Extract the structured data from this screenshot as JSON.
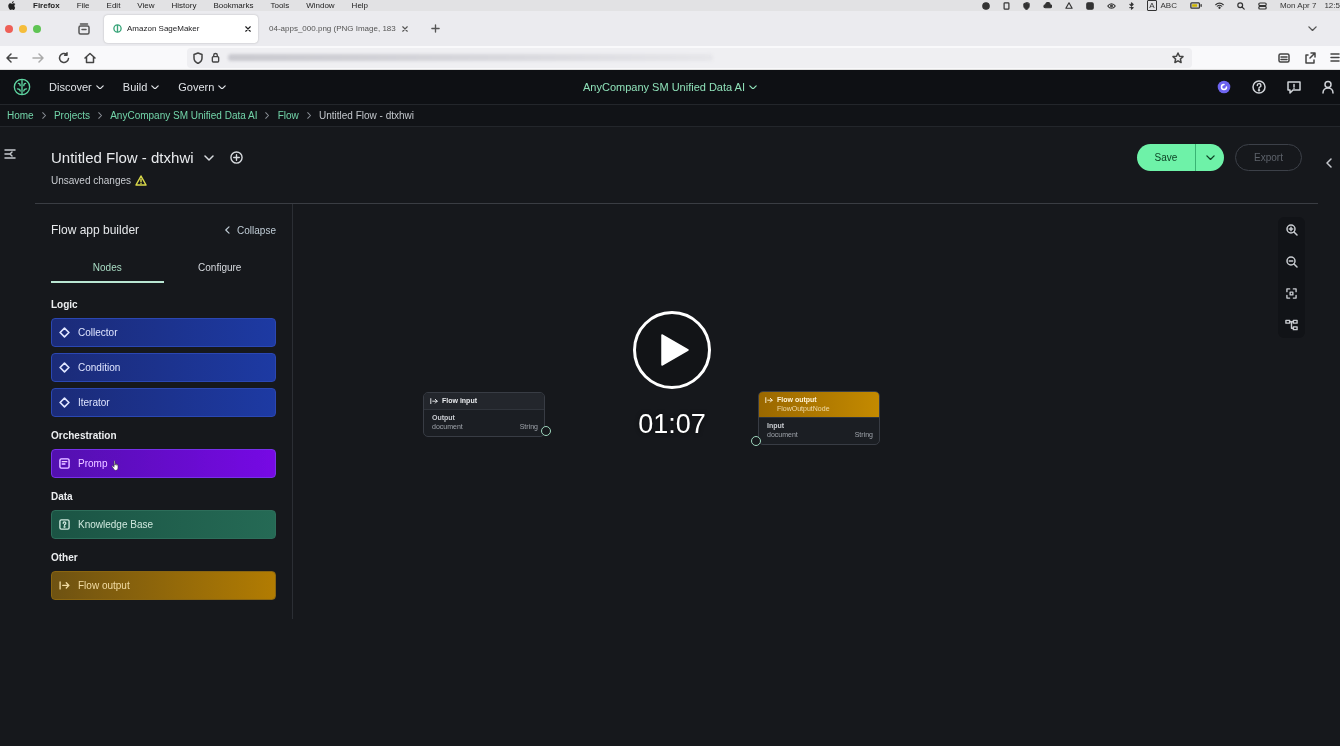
{
  "menu_bar": {
    "items": [
      "Firefox",
      "File",
      "Edit",
      "View",
      "History",
      "Bookmarks",
      "Tools",
      "Window",
      "Help"
    ],
    "input_source": "A",
    "input_label": "ABC",
    "date": "Mon Apr 7",
    "time": "12:5"
  },
  "browser": {
    "tabs": [
      {
        "title": "Amazon SageMaker",
        "selected": true
      },
      {
        "title": "04-apps_000.png (PNG Image, 183",
        "selected": false
      }
    ]
  },
  "app_header": {
    "nav": [
      "Discover",
      "Build",
      "Govern"
    ],
    "domain": "AnyCompany SM Unified Data AI"
  },
  "breadcrumb": [
    {
      "label": "Home",
      "current": false
    },
    {
      "label": "Projects",
      "current": false
    },
    {
      "label": "AnyCompany SM Unified Data AI",
      "current": false
    },
    {
      "label": "Flow",
      "current": false
    },
    {
      "label": "Untitled Flow - dtxhwi",
      "current": true
    }
  ],
  "flow": {
    "title": "Untitled Flow - dtxhwi",
    "status": "Unsaved changes"
  },
  "actions": [
    {
      "label": "Save",
      "kind": "split",
      "disabled": false
    },
    {
      "label": "Export",
      "kind": "outline",
      "disabled": true
    }
  ],
  "builder": {
    "title": "Flow app builder",
    "collapse": "Collapse",
    "tabs": [
      {
        "label": "Nodes",
        "selected": true
      },
      {
        "label": "Configure",
        "selected": false
      }
    ],
    "groups": [
      {
        "heading": "Logic",
        "items": [
          {
            "label": "Collector",
            "kind": "logic",
            "hovered": false
          },
          {
            "label": "Condition",
            "kind": "logic",
            "hovered": false
          },
          {
            "label": "Iterator",
            "kind": "logic",
            "hovered": false
          }
        ]
      },
      {
        "heading": "Orchestration",
        "items": [
          {
            "label": "Promp",
            "kind": "prompt",
            "hovered": true
          }
        ]
      },
      {
        "heading": "Data",
        "items": [
          {
            "label": "Knowledge Base",
            "kind": "knowledge_base",
            "hovered": false
          }
        ]
      },
      {
        "heading": "Other",
        "items": [
          {
            "label": "Flow output",
            "kind": "output",
            "hovered": false
          }
        ]
      }
    ]
  },
  "canvas": {
    "nodes": [
      {
        "kind": "input",
        "title": "Flow input",
        "section": "Output",
        "field": "document",
        "type": "String"
      },
      {
        "kind": "output",
        "title": "Flow output",
        "subtitle": "FlowOutputNode",
        "section": "Input",
        "field": "document",
        "type": "String"
      }
    ]
  },
  "player": {
    "time": "01:07"
  }
}
